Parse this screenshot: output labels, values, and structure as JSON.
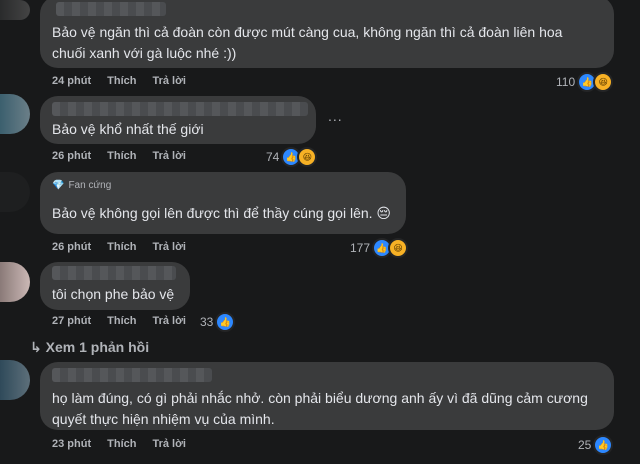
{
  "comments": [
    {
      "text": "Bảo vệ ngăn thì cả đoàn còn được mút càng cua, không ngăn thì cả đoàn liên hoa chuối xanh với gà luộc nhé :))",
      "time": "24 phút",
      "like": "Thích",
      "reply": "Trả lời",
      "reaction_count": "110",
      "reactions": [
        "like-icon",
        "haha-icon"
      ]
    },
    {
      "text": "Bảo vệ khổ nhất thế giới",
      "time": "26 phút",
      "like": "Thích",
      "reply": "Trả lời",
      "reaction_count": "74",
      "reactions": [
        "like-icon",
        "haha-icon"
      ],
      "more": "..."
    },
    {
      "badge": "Fan cứng",
      "text": "Bảo vệ không gọi lên được thì để thầy cúng gọi lên. 😔",
      "time": "26 phút",
      "like": "Thích",
      "reply": "Trả lời",
      "reaction_count": "177",
      "reactions": [
        "like-icon",
        "haha-icon"
      ]
    },
    {
      "text": "tôi chọn phe bảo vệ",
      "time": "27 phút",
      "like": "Thích",
      "reply": "Trả lời",
      "reaction_count": "33",
      "reactions": [
        "like-icon"
      ]
    },
    {
      "text_line1": "họ làm đúng, có gì phải nhắc nhở. còn phải biểu dương anh ấy vì đã dũng cảm cương",
      "text_line2": "quyết thực hiện nhiệm vụ của mình.",
      "time": "23 phút",
      "like": "Thích",
      "reply": "Trả lời",
      "reaction_count": "25",
      "reactions": [
        "like-icon"
      ]
    }
  ],
  "view_replies": "Xem 1 phản hồi"
}
